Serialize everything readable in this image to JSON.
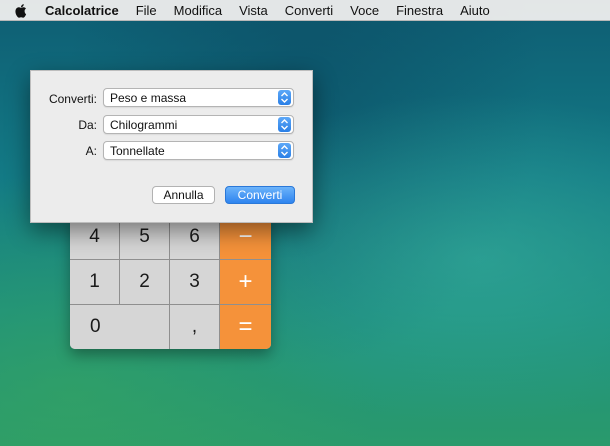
{
  "menubar": {
    "apple_icon": "apple-logo-icon",
    "app_name": "Calcolatrice",
    "items": [
      "File",
      "Modifica",
      "Vista",
      "Converti",
      "Voce",
      "Finestra",
      "Aiuto"
    ]
  },
  "calculator": {
    "keys": {
      "four": "4",
      "five": "5",
      "six": "6",
      "minus": "−",
      "one": "1",
      "two": "2",
      "three": "3",
      "plus": "+",
      "zero": "0",
      "decimal": ",",
      "equals": "="
    },
    "colors": {
      "operator": "#f5923a",
      "digit": "#d6d6d6"
    }
  },
  "dialog": {
    "rows": [
      {
        "label": "Converti:",
        "value": "Peso e massa"
      },
      {
        "label": "Da:",
        "value": "Chilogrammi"
      },
      {
        "label": "A:",
        "value": "Tonnellate"
      }
    ],
    "cancel_label": "Annulla",
    "convert_label": "Converti",
    "accent": "#2e84ef"
  }
}
